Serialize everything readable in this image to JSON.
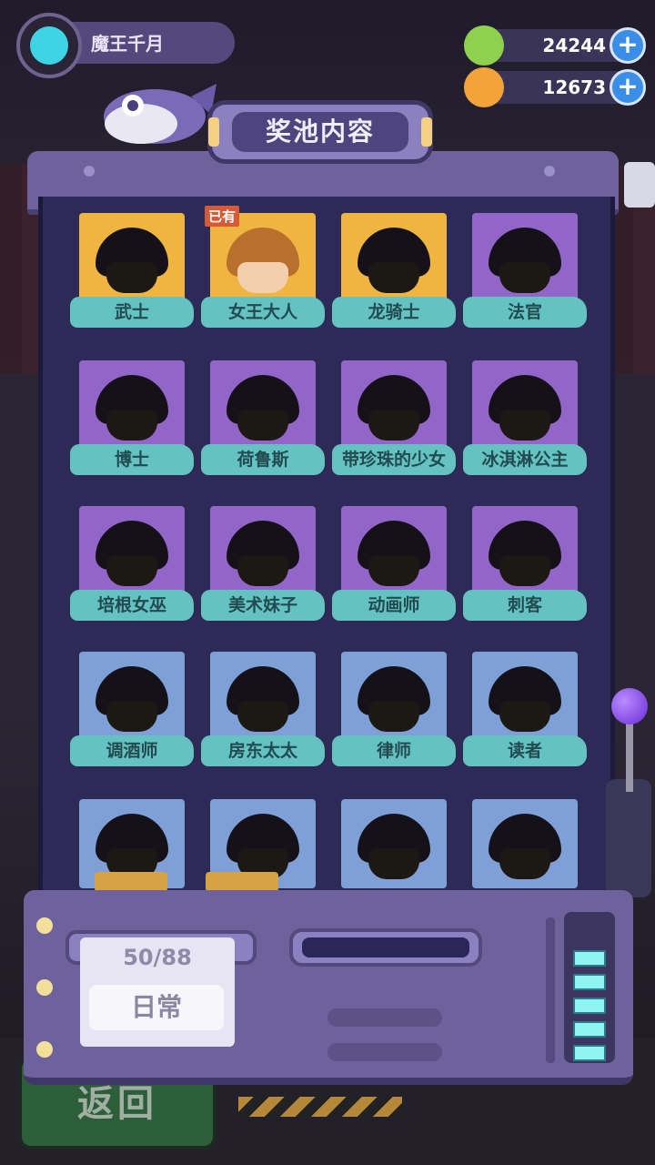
{
  "player": {
    "name": "魔王千月",
    "avatar_icon": "cat-face-icon"
  },
  "currencies": [
    {
      "icon": "green-donut-coin-icon",
      "value": "24244",
      "color": "#8fd14f"
    },
    {
      "icon": "orange-planet-coin-icon",
      "value": "12673",
      "color": "#f2a33a"
    }
  ],
  "panel": {
    "title": "奖池内容"
  },
  "owned_badge": "已有",
  "characters": [
    {
      "name": "武士",
      "rarity": "gold",
      "owned": false
    },
    {
      "name": "女王大人",
      "rarity": "gold",
      "owned": true
    },
    {
      "name": "龙骑士",
      "rarity": "gold",
      "owned": false
    },
    {
      "name": "法官",
      "rarity": "purple",
      "owned": false
    },
    {
      "name": "博士",
      "rarity": "purple",
      "owned": false
    },
    {
      "name": "荷鲁斯",
      "rarity": "purple",
      "owned": false
    },
    {
      "name": "带珍珠的少女",
      "rarity": "purple",
      "owned": false
    },
    {
      "name": "冰淇淋公主",
      "rarity": "purple",
      "owned": false
    },
    {
      "name": "培根女巫",
      "rarity": "purple",
      "owned": false
    },
    {
      "name": "美术妹子",
      "rarity": "purple",
      "owned": false
    },
    {
      "name": "动画师",
      "rarity": "purple",
      "owned": false
    },
    {
      "name": "刺客",
      "rarity": "purple",
      "owned": false
    },
    {
      "name": "调酒师",
      "rarity": "blue",
      "owned": false
    },
    {
      "name": "房东太太",
      "rarity": "blue",
      "owned": false
    },
    {
      "name": "律师",
      "rarity": "blue",
      "owned": false
    },
    {
      "name": "读者",
      "rarity": "blue",
      "owned": false
    },
    {
      "name": "",
      "rarity": "blue",
      "owned": false
    },
    {
      "name": "",
      "rarity": "blue",
      "owned": false
    },
    {
      "name": "",
      "rarity": "blue",
      "owned": false
    },
    {
      "name": "",
      "rarity": "blue",
      "owned": false
    }
  ],
  "rarity_colors": {
    "gold": "#f0b440",
    "purple": "#9266c8",
    "blue": "#7fa0d6"
  },
  "pool_card": {
    "count": "50/88",
    "type": "日常"
  },
  "back_button": {
    "label": "返回"
  },
  "meter": {
    "filled": 5,
    "total": 5
  }
}
